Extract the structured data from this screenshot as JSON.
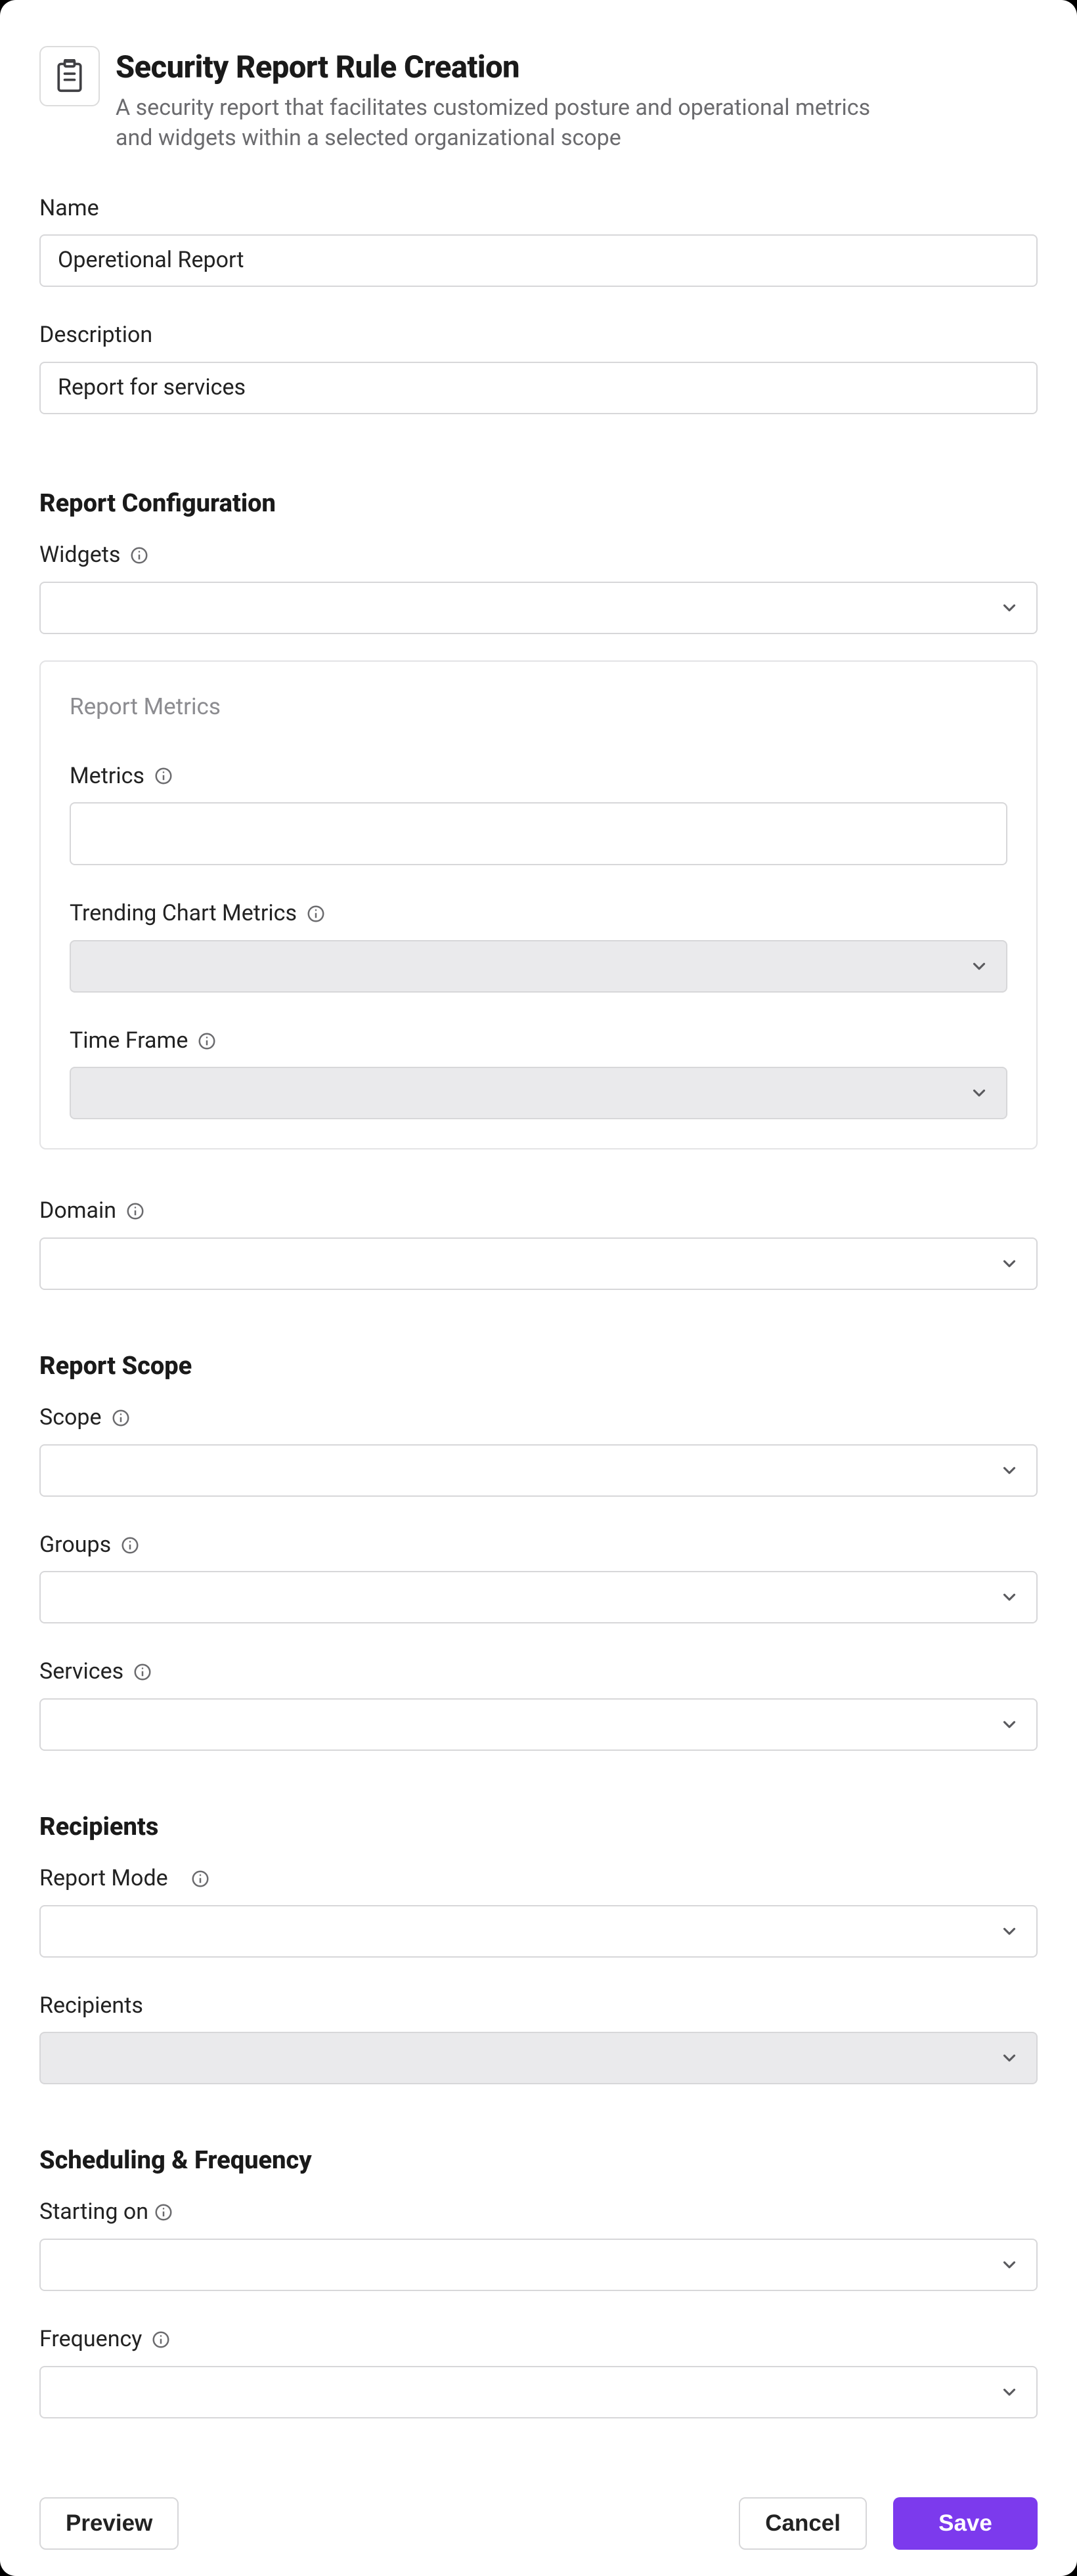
{
  "header": {
    "title": "Security Report Rule Creation",
    "subtitle": "A security report that facilitates customized posture and operational metrics and widgets within a selected organizational scope"
  },
  "fields": {
    "name": {
      "label": "Name",
      "value": "Operetional Report"
    },
    "description": {
      "label": "Description",
      "value": "Report for services"
    }
  },
  "sections": {
    "config": {
      "title": "Report Configuration",
      "widgets": {
        "label": "Widgets"
      },
      "metrics_card": {
        "title": "Report Metrics",
        "metrics": {
          "label": "Metrics"
        },
        "trending": {
          "label": "Trending Chart Metrics"
        },
        "timeframe": {
          "label": "Time Frame"
        }
      },
      "domain": {
        "label": "Domain"
      }
    },
    "scope": {
      "title": "Report Scope",
      "scope": {
        "label": "Scope"
      },
      "groups": {
        "label": "Groups"
      },
      "services": {
        "label": "Services"
      }
    },
    "recipients": {
      "title": "Recipients",
      "report_mode": {
        "label": "Report Mode"
      },
      "recipients": {
        "label": "Recipients"
      }
    },
    "scheduling": {
      "title": "Scheduling & Frequency",
      "starting_on": {
        "label": "Starting on"
      },
      "frequency": {
        "label": "Frequency"
      }
    }
  },
  "footer": {
    "preview": "Preview",
    "cancel": "Cancel",
    "save": "Save"
  }
}
